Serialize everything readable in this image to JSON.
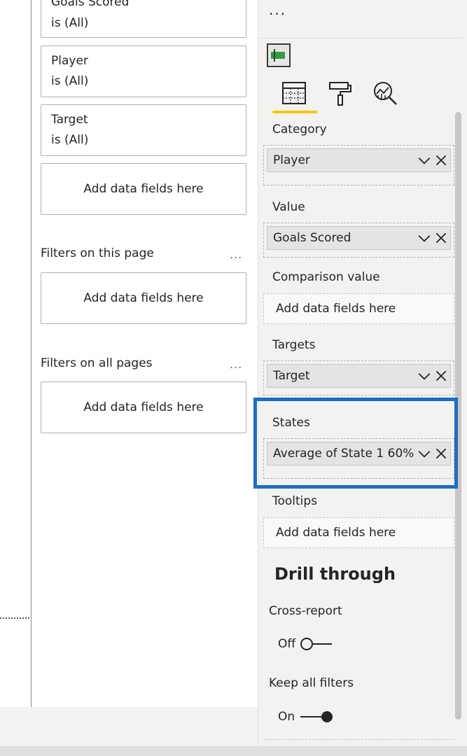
{
  "filters_pane": {
    "visual_filters": [
      {
        "field": "Goals Scored",
        "condition": "is (All)"
      },
      {
        "field": "Player",
        "condition": "is (All)"
      },
      {
        "field": "Target",
        "condition": "is (All)"
      }
    ],
    "add_fields_label": "Add data fields here",
    "page_section_label": "Filters on this page",
    "all_pages_section_label": "Filters on all pages",
    "more_glyph": "..."
  },
  "viz_pane": {
    "more_glyph": "...",
    "selected_visual_icon": "bullet-chart-icon",
    "tabs": [
      {
        "name": "fields",
        "icon": "fields-grid-icon",
        "active": true
      },
      {
        "name": "format",
        "icon": "paint-roller-icon",
        "active": false
      },
      {
        "name": "analytics",
        "icon": "analytics-magnifier-icon",
        "active": false
      }
    ],
    "wells": {
      "category": {
        "label": "Category",
        "field": "Player"
      },
      "value": {
        "label": "Value",
        "field": "Goals Scored"
      },
      "comparison": {
        "label": "Comparison value",
        "placeholder": "Add data fields here"
      },
      "targets": {
        "label": "Targets",
        "field": "Target"
      },
      "states": {
        "label": "States",
        "field": "Average of State 1 60%"
      },
      "tooltips": {
        "label": "Tooltips",
        "placeholder": "Add data fields here"
      }
    },
    "drill_through": {
      "title": "Drill through",
      "cross_report": {
        "label": "Cross-report",
        "state": "Off"
      },
      "keep_all_filters": {
        "label": "Keep all filters",
        "state": "On"
      }
    },
    "colors": {
      "accent": "#f2c811",
      "highlight": "#1a6ec6"
    }
  }
}
